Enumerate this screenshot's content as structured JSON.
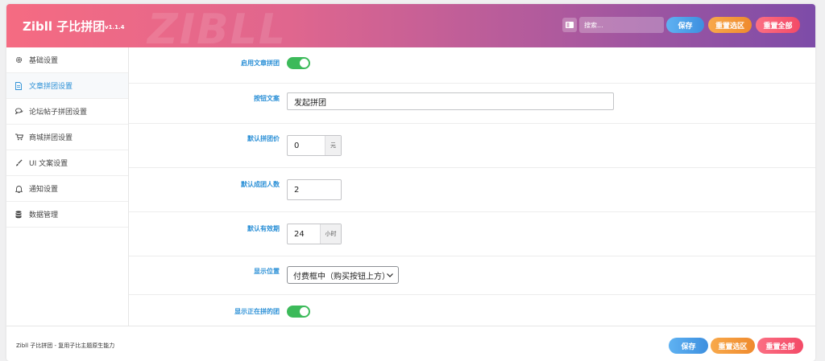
{
  "header": {
    "title": "Zibll 子比拼团",
    "version": "v1.1.4",
    "watermark": "ZIBLL",
    "search_placeholder": "搜索...",
    "save_label": "保存",
    "reset_section_label": "重置选区",
    "reset_all_label": "重置全部"
  },
  "sidebar": {
    "items": [
      {
        "label": "基础设置",
        "icon": "gear-icon"
      },
      {
        "label": "文章拼团设置",
        "icon": "document-icon",
        "active": true
      },
      {
        "label": "论坛帖子拼团设置",
        "icon": "chat-icon"
      },
      {
        "label": "商城拼团设置",
        "icon": "cart-icon"
      },
      {
        "label": "UI 文案设置",
        "icon": "brush-icon"
      },
      {
        "label": "通知设置",
        "icon": "bell-icon"
      },
      {
        "label": "数据管理",
        "icon": "database-icon"
      }
    ]
  },
  "form": {
    "enable_label": "启用文章拼团",
    "enable_value": true,
    "button_text_label": "按钮文案",
    "button_text_value": "发起拼团",
    "price_label": "默认拼团价",
    "price_value": "0",
    "price_unit": "元",
    "members_label": "默认成团人数",
    "members_value": "2",
    "validity_label": "默认有效期",
    "validity_value": "24",
    "validity_unit": "小时",
    "position_label": "显示位置",
    "position_value": "付费框中（购买按钮上方）",
    "show_ongoing_label": "显示正在拼的团",
    "show_ongoing_value": true
  },
  "footer": {
    "text": "Zibll 子比拼团 - 复用子比主题原生能力",
    "save_label": "保存",
    "reset_section_label": "重置选区",
    "reset_all_label": "重置全部"
  },
  "colors": {
    "accent": "#2a8fd6",
    "toggle_on": "#3cba5a",
    "header_start": "#f56b82",
    "header_end": "#7d4ca8"
  }
}
